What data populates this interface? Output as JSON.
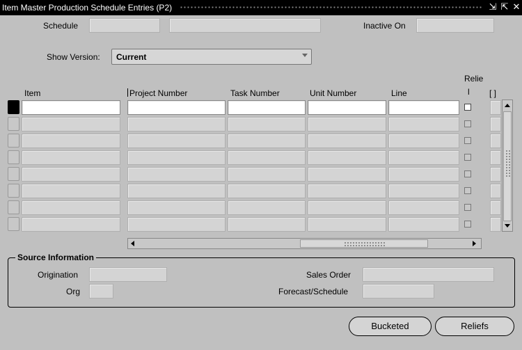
{
  "window": {
    "title": "Item Master Production Schedule Entries (P2)",
    "minimize_glyph": "⇲",
    "restore_glyph": "⇱",
    "close_glyph": "✕"
  },
  "header": {
    "schedule_label": "Schedule",
    "schedule_value": "",
    "schedule_desc_value": "",
    "inactive_on_label": "Inactive On",
    "inactive_on_value": ""
  },
  "version": {
    "label": "Show Version:",
    "selected": "Current"
  },
  "grid": {
    "columns": {
      "item": "Item",
      "project_number": "Project Number",
      "task_number": "Task Number",
      "unit_number": "Unit Number",
      "line": "Line",
      "relief_top": "Relie",
      "relief_bottom": "l",
      "extra": "[ ]"
    },
    "rows": [
      {
        "item": "",
        "project_number": "",
        "task_number": "",
        "unit_number": "",
        "line": "",
        "relief": false
      },
      {
        "item": "",
        "project_number": "",
        "task_number": "",
        "unit_number": "",
        "line": "",
        "relief": false
      },
      {
        "item": "",
        "project_number": "",
        "task_number": "",
        "unit_number": "",
        "line": "",
        "relief": false
      },
      {
        "item": "",
        "project_number": "",
        "task_number": "",
        "unit_number": "",
        "line": "",
        "relief": false
      },
      {
        "item": "",
        "project_number": "",
        "task_number": "",
        "unit_number": "",
        "line": "",
        "relief": false
      },
      {
        "item": "",
        "project_number": "",
        "task_number": "",
        "unit_number": "",
        "line": "",
        "relief": false
      },
      {
        "item": "",
        "project_number": "",
        "task_number": "",
        "unit_number": "",
        "line": "",
        "relief": false
      },
      {
        "item": "",
        "project_number": "",
        "task_number": "",
        "unit_number": "",
        "line": "",
        "relief": false
      }
    ]
  },
  "source": {
    "title": "Source Information",
    "origination_label": "Origination",
    "origination_value": "",
    "org_label": "Org",
    "org_value": "",
    "sales_order_label": "Sales Order",
    "sales_order_value": "",
    "forecast_label": "Forecast/Schedule",
    "forecast_value": ""
  },
  "buttons": {
    "bucketed": "Bucketed",
    "reliefs": "Reliefs"
  }
}
